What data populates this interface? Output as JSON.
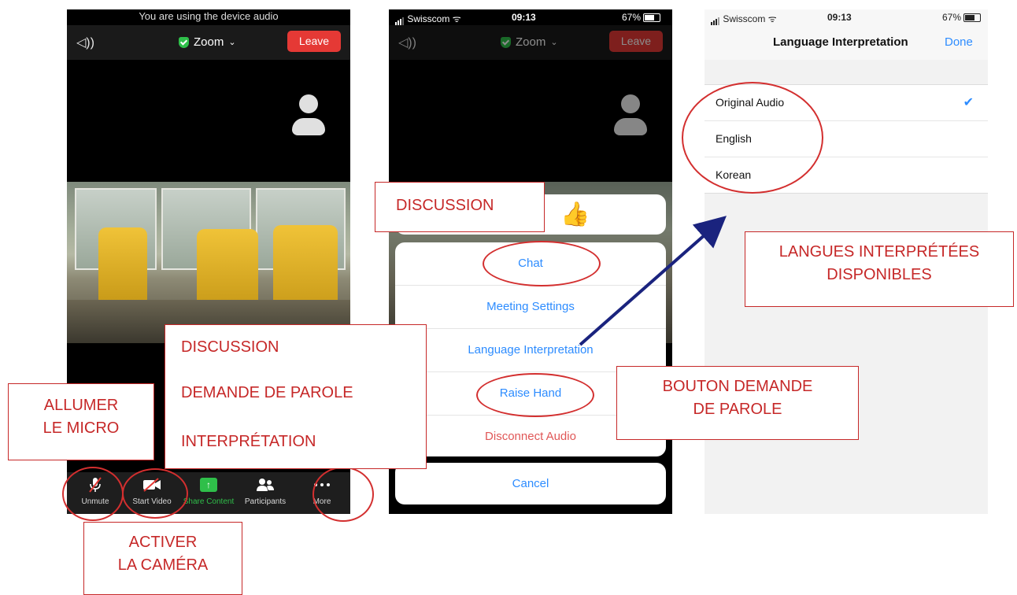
{
  "phone1": {
    "banner": "You are using the device audio",
    "meeting_title": "Zoom",
    "leave_label": "Leave",
    "toolbar": [
      {
        "label": "Unmute",
        "icon": "microphone-muted-icon"
      },
      {
        "label": "Start Video",
        "icon": "video-camera-off-icon"
      },
      {
        "label": "Share Content",
        "icon": "share-screen-icon"
      },
      {
        "label": "Participants",
        "icon": "participants-icon"
      },
      {
        "label": "More",
        "icon": "more-dots-icon"
      }
    ]
  },
  "phone2": {
    "status": {
      "carrier": "Swisscom",
      "time": "09:13",
      "battery": "67%"
    },
    "meeting_title": "Zoom",
    "leave_label": "Leave",
    "reaction": "👍",
    "menu": [
      "Chat",
      "Meeting Settings",
      "Language Interpretation",
      "Raise Hand",
      "Disconnect Audio"
    ],
    "cancel_label": "Cancel"
  },
  "phone3": {
    "status": {
      "carrier": "Swisscom",
      "time": "09:13",
      "battery": "67%"
    },
    "title": "Language Interpretation",
    "done_label": "Done",
    "languages": [
      "Original Audio",
      "English",
      "Korean"
    ],
    "selected_language": "Original Audio"
  },
  "annotations": {
    "discussion_top": "DISCUSSION",
    "features": [
      "DISCUSSION",
      "DEMANDE DE PAROLE",
      "INTERPRÉTATION"
    ],
    "mic": [
      "ALLUMER",
      "LE MICRO"
    ],
    "camera": [
      "ACTIVER",
      "LA CAMÉRA"
    ],
    "raise_hand": [
      "BOUTON DEMANDE",
      "DE PAROLE"
    ],
    "languages": [
      "LANGUES INTERPRÉTÉES",
      "DISPONIBLES"
    ]
  },
  "colors": {
    "leave_red": "#e53935",
    "zoom_blue": "#2d8cff",
    "share_green": "#2fbf4a",
    "annotation_red": "#c62828",
    "arrow_navy": "#1a237e"
  }
}
